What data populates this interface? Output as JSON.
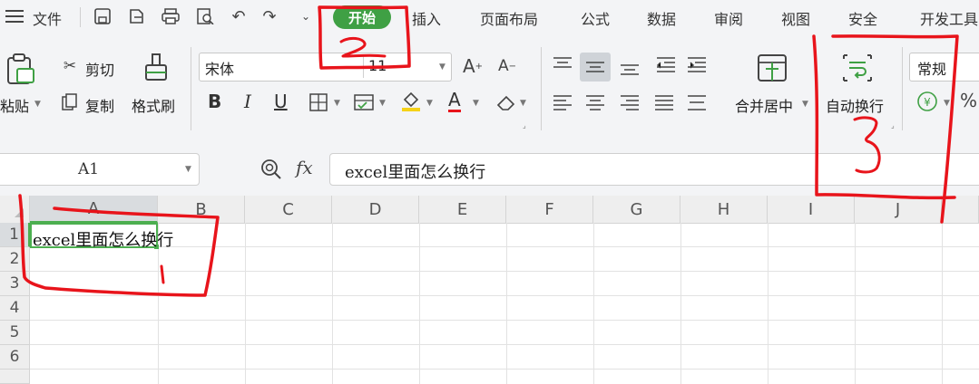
{
  "menu": {
    "hamburger_icon": "menu-icon",
    "file": "文件",
    "tabs": [
      "开始",
      "插入",
      "页面布局",
      "公式",
      "数据",
      "审阅",
      "视图",
      "安全",
      "开发工具"
    ],
    "active_tab": "开始"
  },
  "ribbon": {
    "paste": "粘贴",
    "cut": "剪切",
    "copy": "复制",
    "format_painter": "格式刷",
    "font_name": "宋体",
    "font_size": "11",
    "bold": "B",
    "italic": "I",
    "underline": "U",
    "font_color_letter": "A",
    "merge_center": "合并居中",
    "wrap_text": "自动换行",
    "number_format": "常规",
    "percent": "%"
  },
  "formula_bar": {
    "name_box": "A1",
    "fx_label": "fx",
    "content": "excel里面怎么换行"
  },
  "sheet": {
    "columns": [
      "A",
      "B",
      "C",
      "D",
      "E",
      "F",
      "G",
      "H",
      "I",
      "J"
    ],
    "rows": [
      "1",
      "2",
      "3",
      "4",
      "5",
      "6"
    ],
    "a1_value": "excel里面怎么换行"
  },
  "annotations": {
    "color": "#e8141b",
    "labels": [
      "1",
      "2",
      "3"
    ]
  },
  "colors": {
    "accent_green": "#3fa044",
    "selection_border": "#4caf50"
  }
}
